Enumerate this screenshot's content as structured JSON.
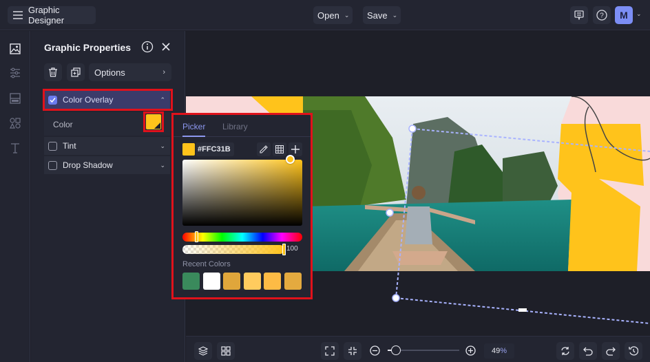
{
  "topbar": {
    "app_title": "Graphic Designer",
    "open_label": "Open",
    "save_label": "Save",
    "avatar_initial": "M"
  },
  "icons": {
    "menu": "menu-icon",
    "comments": "comments-icon",
    "help": "help-icon",
    "rail": [
      "image-icon",
      "adjustments-icon",
      "layout-icon",
      "shapes-icon",
      "text-icon"
    ]
  },
  "panel": {
    "title": "Graphic Properties",
    "options_label": "Options",
    "sections": [
      {
        "label": "Color Overlay",
        "checked": true,
        "expanded": true
      },
      {
        "label": "Tint",
        "checked": false,
        "expanded": false
      },
      {
        "label": "Drop Shadow",
        "checked": false,
        "expanded": false
      }
    ],
    "color_label": "Color",
    "color_value": "#FFC31B"
  },
  "picker": {
    "tabs": [
      {
        "label": "Picker",
        "active": true
      },
      {
        "label": "Library",
        "active": false
      }
    ],
    "hex": "#FFC31B",
    "opacity": "100",
    "recent_label": "Recent Colors",
    "recent_colors": [
      "#3a8a5c",
      "#ffffff",
      "#e0a63b",
      "#ffcb5e",
      "#fdbb45",
      "#e4aa3f"
    ]
  },
  "bottombar": {
    "zoom_value": "49",
    "zoom_unit": "%",
    "zoom_fraction": 0.1
  },
  "colors": {
    "accent": "#7c8ef5",
    "overlay": "#FFC31B",
    "highlight": "#e0121b"
  }
}
